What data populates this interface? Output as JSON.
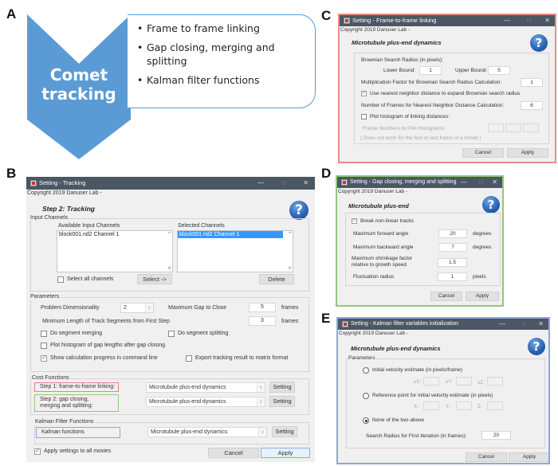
{
  "panel_labels": [
    "A",
    "B",
    "C",
    "D",
    "E"
  ],
  "panel_a": {
    "chevron_text": [
      "Comet",
      "tracking"
    ],
    "chevron_color": "#5b9bd5",
    "bullets": [
      "Frame to frame linking",
      "Gap closing, merging and splitting",
      "Kalman filter functions"
    ]
  },
  "window_controls": {
    "minimize": "—",
    "maximize": "□",
    "close": "✕"
  },
  "copyright": "Copyright 2019 Danuser Lab -",
  "help_glyph": "?",
  "tracking": {
    "title": "Setting - Tracking",
    "step_title": "Step 2: Tracking",
    "input_channels": {
      "label": "Input Channels",
      "available_label": "Available Input Channels",
      "available_items": [
        "block001.nd2 Channel 1"
      ],
      "selected_label": "Selected Channels",
      "selected_items": [
        "block001.nd2 Channel 1"
      ],
      "select_all_label": "Select all channels",
      "select_all_checked": false,
      "select_button": "Select ->",
      "delete_button": "Delete"
    },
    "parameters": {
      "label": "Parameters",
      "dimensionality_label": "Problem Dimensionality",
      "dimensionality_value": "2",
      "max_gap_label": "Maximum Gap to Close",
      "max_gap_value": "5",
      "max_gap_unit": "frames",
      "min_length_label": "Minimum Length of Track Segments from First Step",
      "min_length_value": "3",
      "min_length_unit": "frames",
      "segment_merging_label": "Do segment merging",
      "segment_merging_checked": false,
      "segment_splitting_label": "Do segment splitting",
      "segment_splitting_checked": false,
      "plot_histogram_label": "Plot histogram of gap lengths after gap closing",
      "plot_histogram_checked": false,
      "show_progress_label": "Show calculation progress in command line",
      "show_progress_checked": true,
      "export_label": "Export tracking result to matrix format",
      "export_checked": false
    },
    "cost_functions": {
      "label": "Cost Functions",
      "step1_label": "Step 1: frame-to-frame linking:",
      "step1_value": "Microtubule plus-end dynamics",
      "step1_highlight": "#f08080",
      "step2_label_line1": "Step 2: gap closing,",
      "step2_label_line2": "merging and splitting:",
      "step2_value": "Microtubule plus-end dynamics",
      "step2_highlight": "#8fc97a",
      "setting_button": "Setting"
    },
    "kalman": {
      "label": "Kalman Filter Functions",
      "functions_label": "Kalman functions",
      "functions_value": "Microtubule plus-end dynamics",
      "highlight": "#8fa6d8",
      "setting_button": "Setting"
    },
    "apply_all_label": "Apply settings to all movies",
    "apply_all_checked": true,
    "cancel_button": "Cancel",
    "apply_button": "Apply"
  },
  "frame_linking": {
    "title": "Setting - Frame-to-frame linking",
    "border_color": "#f08a8a",
    "subtitle": "Microtubule plus-end dynamics",
    "brownian_label": "Brownian Search Radius (in pixels):",
    "lower_label": "Lower Bound:",
    "lower_value": "1",
    "upper_label": "Upper Bound:",
    "upper_value": "5",
    "mult_factor_label": "Multiplication Factor for Brownian Search Radius Calculation:",
    "mult_factor_value": "1",
    "nearest_neighbor_label": "Use nearest neighbor distance to expand Brownian search radius",
    "nearest_neighbor_checked": true,
    "nn_frames_label": "Number of Frames for Nearest Neighbor Distance Calculation:",
    "nn_frames_value": "6",
    "plot_hist_label": "Plot histogram of linking distances:",
    "plot_hist_checked": false,
    "frame_numbers_label": "Frame Numbers to Plot Histograms:",
    "note": "( Does not work for the first or last frame of a movie )",
    "cancel_button": "Cancel",
    "apply_button": "Apply"
  },
  "gap_closing": {
    "title": "Setting - Gap closing, merging and splitting",
    "border_color": "#8fc97a",
    "subtitle": "Microtubule plus-end",
    "break_nonlinear_label": "Break non-linear tracks",
    "break_nonlinear_checked": true,
    "fwd_angle_label": "Maximum forward angle",
    "fwd_angle_value": "20",
    "fwd_angle_unit": "degrees",
    "bwd_angle_label": "Maximum backward angle",
    "bwd_angle_value": "7",
    "bwd_angle_unit": "degrees",
    "shrink_label_line1": "Maximum shrinkage factor",
    "shrink_label_line2": "relative to growth speed",
    "shrink_value": "1.5",
    "fluct_label": "Fluctuation radius",
    "fluct_value": "1",
    "fluct_unit": "pixels",
    "cancel_button": "Cancel",
    "apply_button": "Apply"
  },
  "kalman_init": {
    "title": "Setting - Kalman filter variables initialization",
    "border_color": "#8fa6d8",
    "subtitle": "Microtubule plus-end dynamics",
    "params_label": "Parameters",
    "opt1_label": "Initial velocity estimate (in pixels/frame)",
    "opt1_selected": false,
    "vx_label": "vX:",
    "vy_label": "vY:",
    "vz_label": "vZ:",
    "opt2_label": "Reference point for initial velocity estimate (in pixels)",
    "opt2_selected": false,
    "x_label": "X:",
    "y_label": "Y:",
    "z_label": "Z:",
    "opt3_label": "None of the two above",
    "opt3_selected": true,
    "search_radius_label": "Search Radius for First Iteration (in frames):",
    "search_radius_value": "20",
    "cancel_button": "Cancel",
    "apply_button": "Apply"
  }
}
